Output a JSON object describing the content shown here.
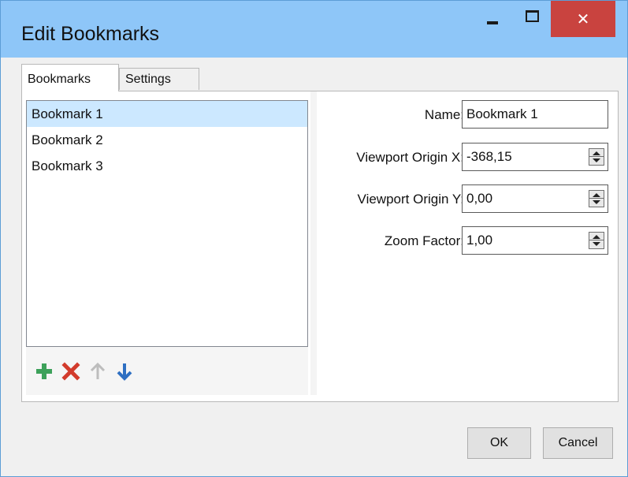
{
  "window": {
    "title": "Edit Bookmarks",
    "minimize_glyph": "–",
    "maximize_glyph": "□",
    "close_glyph": "✕"
  },
  "tabs": [
    {
      "label": "Bookmarks",
      "active": true
    },
    {
      "label": "Settings",
      "active": false
    }
  ],
  "bookmarks": {
    "items": [
      "Bookmark 1",
      "Bookmark 2",
      "Bookmark 3"
    ],
    "selected_index": 0
  },
  "toolbar": {
    "icons": [
      "add-icon",
      "delete-icon",
      "move-up-icon",
      "move-down-icon"
    ],
    "colors": {
      "add": "#3da15a",
      "delete": "#d23b2c",
      "up_disabled": "#bdbdbd",
      "down": "#2e6fc2"
    }
  },
  "form": {
    "name_label": "Name:",
    "name_value": "Bookmark 1",
    "origin_x_label": "Viewport Origin X:",
    "origin_x_value": "-368,15",
    "origin_y_label": "Viewport Origin Y:",
    "origin_y_value": "0,00",
    "zoom_label": "Zoom Factor:",
    "zoom_value": "1,00"
  },
  "buttons": {
    "ok_label": "OK",
    "cancel_label": "Cancel"
  },
  "colors": {
    "titlebar": "#8ec6f8",
    "close_button": "#c9433f",
    "selection": "#cce8ff"
  }
}
